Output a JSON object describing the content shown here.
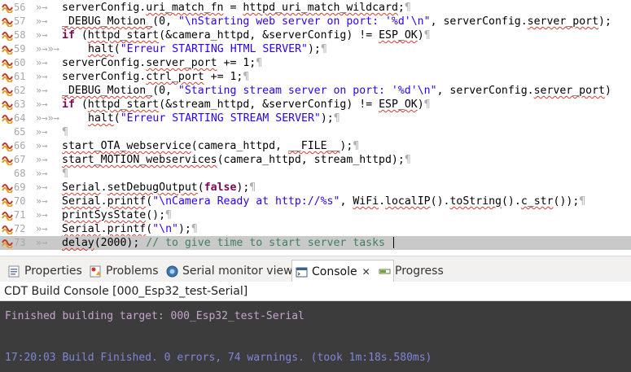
{
  "editor": {
    "lines": [
      {
        "num": "56",
        "icon": true,
        "indent": "»→",
        "segments": [
          {
            "t": "serverConfig.",
            "c": ""
          },
          {
            "t": "uri_match_fn",
            "c": "sq"
          },
          {
            "t": " = ",
            "c": ""
          },
          {
            "t": "httpd_uri_match_wildcard",
            "c": "sq"
          },
          {
            "t": ";",
            "c": ""
          },
          {
            "t": "¶",
            "c": "pil"
          }
        ]
      },
      {
        "num": "57",
        "icon": true,
        "indent": "»→",
        "segments": [
          {
            "t": "_DEBUG_Motion_",
            "c": "sq"
          },
          {
            "t": "(0, ",
            "c": ""
          },
          {
            "t": "\"\\nStarting web server on port: '%d'\\n\"",
            "c": "str"
          },
          {
            "t": ", serverConfig.",
            "c": ""
          },
          {
            "t": "server_port",
            "c": "sq"
          },
          {
            "t": ");",
            "c": ""
          }
        ]
      },
      {
        "num": "58",
        "icon": true,
        "indent": "»→",
        "segments": [
          {
            "t": "if",
            "c": "kw"
          },
          {
            "t": " (",
            "c": ""
          },
          {
            "t": "httpd_start",
            "c": "sq"
          },
          {
            "t": "(&camera_httpd, &serverConfig) != ",
            "c": ""
          },
          {
            "t": "ESP_OK",
            "c": "sq"
          },
          {
            "t": ")",
            "c": ""
          },
          {
            "t": "¶",
            "c": "pil"
          }
        ]
      },
      {
        "num": "59",
        "icon": true,
        "indent": "»→»→",
        "segments": [
          {
            "t": "halt",
            "c": "sq"
          },
          {
            "t": "(",
            "c": ""
          },
          {
            "t": "\"Erreur STARTING HTML SERVER\"",
            "c": "str"
          },
          {
            "t": ");",
            "c": ""
          },
          {
            "t": "¶",
            "c": "pil"
          }
        ]
      },
      {
        "num": "60",
        "icon": true,
        "indent": "»→",
        "segments": [
          {
            "t": "serverConfig.",
            "c": ""
          },
          {
            "t": "server_port",
            "c": "sq"
          },
          {
            "t": " += 1;",
            "c": ""
          },
          {
            "t": "¶",
            "c": "pil"
          }
        ]
      },
      {
        "num": "61",
        "icon": true,
        "indent": "»→",
        "segments": [
          {
            "t": "serverConfig.",
            "c": ""
          },
          {
            "t": "ctrl_port",
            "c": "sq"
          },
          {
            "t": " += 1;",
            "c": ""
          },
          {
            "t": "¶",
            "c": "pil"
          }
        ]
      },
      {
        "num": "62",
        "icon": true,
        "indent": "»→",
        "segments": [
          {
            "t": "_DEBUG_Motion_",
            "c": "sq"
          },
          {
            "t": "(0, ",
            "c": ""
          },
          {
            "t": "\"Starting stream server on port: '%d'\\n\"",
            "c": "str"
          },
          {
            "t": ", serverConfig.",
            "c": ""
          },
          {
            "t": "server_port",
            "c": "sq"
          },
          {
            "t": ")",
            "c": ""
          }
        ]
      },
      {
        "num": "63",
        "icon": true,
        "indent": "»→",
        "segments": [
          {
            "t": "if",
            "c": "kw"
          },
          {
            "t": " (",
            "c": ""
          },
          {
            "t": "httpd_start",
            "c": "sq"
          },
          {
            "t": "(&stream_httpd, &serverConfig) != ",
            "c": ""
          },
          {
            "t": "ESP_OK",
            "c": "sq"
          },
          {
            "t": ")",
            "c": ""
          },
          {
            "t": "¶",
            "c": "pil"
          }
        ]
      },
      {
        "num": "64",
        "icon": true,
        "indent": "»→»→",
        "segments": [
          {
            "t": "halt",
            "c": "sq"
          },
          {
            "t": "(",
            "c": ""
          },
          {
            "t": "\"Erreur STARTING STREAM SERVER\"",
            "c": "str"
          },
          {
            "t": ");",
            "c": ""
          },
          {
            "t": "¶",
            "c": "pil"
          }
        ]
      },
      {
        "num": "65",
        "icon": false,
        "indent": "»→",
        "segments": [
          {
            "t": "¶",
            "c": "pil"
          }
        ]
      },
      {
        "num": "66",
        "icon": true,
        "indent": "»→",
        "segments": [
          {
            "t": "start_OTA_webservice",
            "c": "sq"
          },
          {
            "t": "(camera_httpd, ",
            "c": ""
          },
          {
            "t": "__FILE__",
            "c": "sq"
          },
          {
            "t": ");",
            "c": ""
          },
          {
            "t": "¶",
            "c": "pil"
          }
        ]
      },
      {
        "num": "67",
        "icon": true,
        "indent": "»→",
        "segments": [
          {
            "t": "start_MOTION_webservices",
            "c": "sq"
          },
          {
            "t": "(camera_httpd, stream_httpd);",
            "c": ""
          },
          {
            "t": "¶",
            "c": "pil"
          }
        ]
      },
      {
        "num": "68",
        "icon": false,
        "indent": "»→",
        "segments": [
          {
            "t": "¶",
            "c": "pil"
          }
        ]
      },
      {
        "num": "69",
        "icon": true,
        "indent": "»→",
        "segments": [
          {
            "t": "Serial",
            "c": "sq"
          },
          {
            "t": ".",
            "c": ""
          },
          {
            "t": "setDebugOutput",
            "c": "sq"
          },
          {
            "t": "(",
            "c": ""
          },
          {
            "t": "false",
            "c": "kw"
          },
          {
            "t": ");",
            "c": ""
          },
          {
            "t": "¶",
            "c": "pil"
          }
        ]
      },
      {
        "num": "70",
        "icon": true,
        "indent": "»→",
        "segments": [
          {
            "t": "Serial",
            "c": "sq"
          },
          {
            "t": ".",
            "c": ""
          },
          {
            "t": "printf",
            "c": "sq"
          },
          {
            "t": "(",
            "c": ""
          },
          {
            "t": "\"\\nCamera Ready at http://%s\"",
            "c": "str"
          },
          {
            "t": ", ",
            "c": ""
          },
          {
            "t": "WiFi",
            "c": "sq"
          },
          {
            "t": ".",
            "c": ""
          },
          {
            "t": "localIP",
            "c": "sq"
          },
          {
            "t": "().",
            "c": ""
          },
          {
            "t": "toString",
            "c": "sq"
          },
          {
            "t": "().",
            "c": ""
          },
          {
            "t": "c_str",
            "c": "sq"
          },
          {
            "t": "());",
            "c": ""
          },
          {
            "t": "¶",
            "c": "pil"
          }
        ]
      },
      {
        "num": "71",
        "icon": true,
        "indent": "»→",
        "segments": [
          {
            "t": "printSysState",
            "c": "sq"
          },
          {
            "t": "();",
            "c": ""
          },
          {
            "t": "¶",
            "c": "pil"
          }
        ]
      },
      {
        "num": "72",
        "icon": true,
        "indent": "»→",
        "segments": [
          {
            "t": "Serial",
            "c": "sq"
          },
          {
            "t": ".",
            "c": ""
          },
          {
            "t": "printf",
            "c": "sq"
          },
          {
            "t": "(",
            "c": ""
          },
          {
            "t": "\"\\n\"",
            "c": "str"
          },
          {
            "t": ");",
            "c": ""
          },
          {
            "t": "¶",
            "c": "pil"
          }
        ]
      },
      {
        "num": "73",
        "icon": true,
        "indent": "»→",
        "current": true,
        "segments": [
          {
            "t": "delay",
            "c": "sq"
          },
          {
            "t": "(2000); ",
            "c": ""
          },
          {
            "t": "// to give time to start server tasks ",
            "c": "cm"
          }
        ]
      }
    ]
  },
  "tabs": [
    {
      "label": "Properties",
      "icon": "properties-icon",
      "active": false
    },
    {
      "label": "Problems",
      "icon": "problems-icon",
      "active": false
    },
    {
      "label": "Serial monitor view",
      "icon": "serial-monitor-icon",
      "active": false
    },
    {
      "label": "Console",
      "icon": "console-icon",
      "active": true
    },
    {
      "label": "Progress",
      "icon": "progress-icon",
      "active": false
    }
  ],
  "console": {
    "title": "CDT Build Console [000_Esp32_test-Serial]",
    "lines": [
      {
        "text": "Finished building target: 000_Esp32_test-Serial",
        "color": "#c6a3cf"
      },
      {
        "text": "17:20:03 Build Finished. 0 errors, 74 warnings. (took 1m:18s.580ms)",
        "color": "#7f86d8"
      }
    ]
  },
  "colors": {
    "current_line": "#c9c9c9",
    "console_bg": "#3c3c3c"
  }
}
